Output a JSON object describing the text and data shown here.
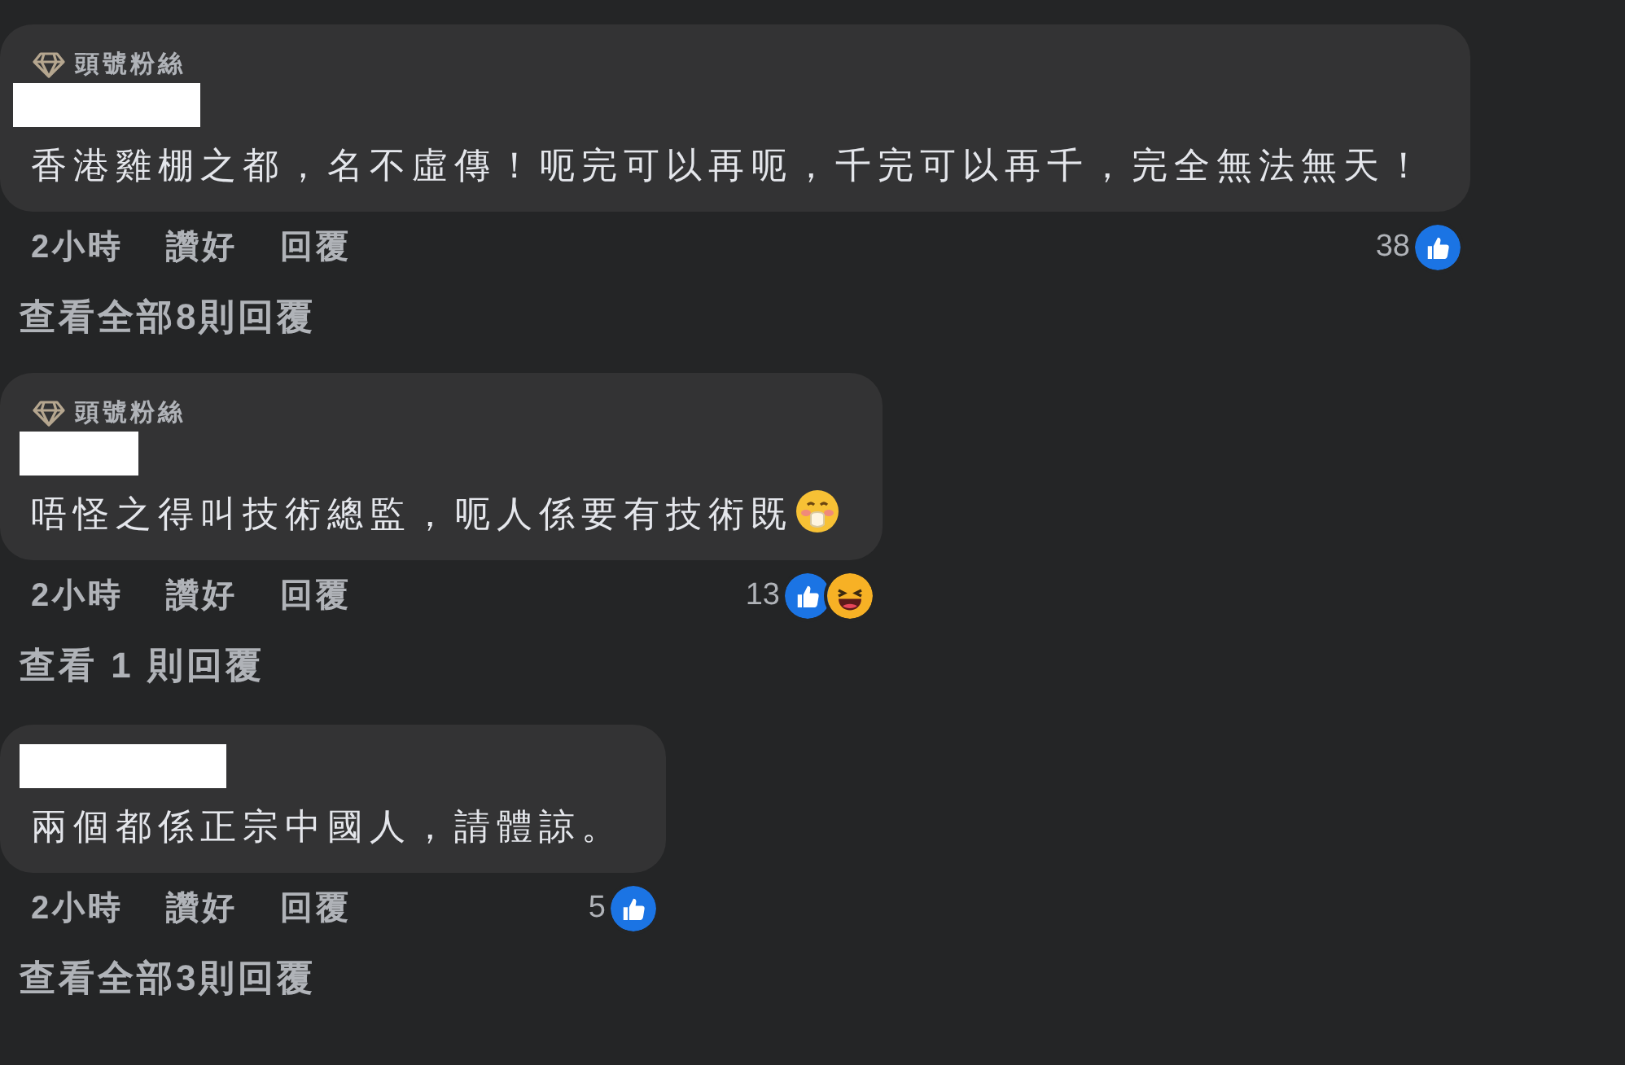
{
  "comments": [
    {
      "badge": "頭號粉絲",
      "text": "香港雞棚之都，名不虛傳！呃完可以再呃，千完可以再千，完全無法無天！",
      "emoji": false,
      "time": "2小時",
      "like": "讚好",
      "reply": "回覆",
      "count": "38",
      "reactions": [
        {
          "kind": "like"
        }
      ],
      "view_replies": "查看全部8則回覆"
    },
    {
      "badge": "頭號粉絲",
      "text": "唔怪之得叫技術總監，呃人係要有技術既",
      "emoji": true,
      "time": "2小時",
      "like": "讚好",
      "reply": "回覆",
      "count": "13",
      "reactions": [
        {
          "kind": "like"
        },
        {
          "kind": "laugh"
        }
      ],
      "view_replies": "查看 1 則回覆"
    },
    {
      "text": "兩個都係正宗中國人，請體諒。",
      "emoji": false,
      "time": "2小時",
      "like": "讚好",
      "reply": "回覆",
      "count": "5",
      "reactions": [
        {
          "kind": "like"
        }
      ],
      "view_replies": "查看全部3則回覆"
    }
  ]
}
